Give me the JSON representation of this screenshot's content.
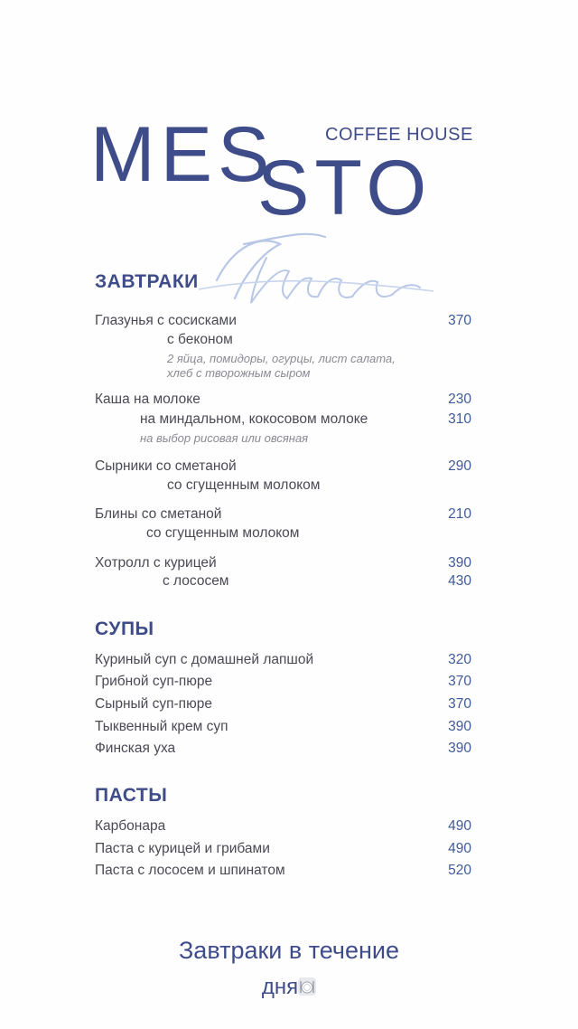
{
  "brand": {
    "mes": "MES",
    "sto": "STO",
    "tagline": "COFFEE HOUSE",
    "script": "Menu"
  },
  "sections": {
    "breakfast": {
      "title": "ЗАВТРАКИ",
      "items": [
        {
          "name": "Глазунья с сосисками",
          "sub": "с беконом",
          "note1": "2 яйца, помидоры, огурцы, лист салата,",
          "note2": "хлеб с творожным сыром",
          "price": "370"
        },
        {
          "name": "Каша на молоке",
          "sub": "на миндальном, кокосовом молоке",
          "note": "на выбор рисовая или овсяная",
          "price": "230",
          "price2": "310"
        },
        {
          "name": "Сырники со сметаной",
          "sub": "со сгущенным молоком",
          "price": "290"
        },
        {
          "name": "Блины со сметаной",
          "sub": "со сгущенным молоком",
          "price": "210"
        },
        {
          "name": "Хотролл с курицей",
          "sub": "с лососем",
          "price": "390",
          "price2": "430"
        }
      ]
    },
    "soups": {
      "title": "СУПЫ",
      "items": [
        {
          "name": "Куриный суп с домашней лапшой",
          "price": "320"
        },
        {
          "name": "Грибной суп-пюре",
          "price": "370"
        },
        {
          "name": "Сырный суп-пюре",
          "price": "370"
        },
        {
          "name": "Тыквенный крем суп",
          "price": "390"
        },
        {
          "name": "Финская уха",
          "price": "390"
        }
      ]
    },
    "pastas": {
      "title": "ПАСТЫ",
      "items": [
        {
          "name": "Карбонара",
          "price": "490"
        },
        {
          "name": "Паста с курицей и грибами",
          "price": "490"
        },
        {
          "name": "Паста с лососем и шпинатом",
          "price": "520"
        }
      ]
    }
  },
  "footer": {
    "line1": "Завтраки в течение",
    "line2": "дня",
    "icon": "plate-icon"
  },
  "colors": {
    "brand": "#3f4c8a",
    "price": "#3f5a9a",
    "text": "#4a4a55",
    "note": "#8a8a94"
  }
}
